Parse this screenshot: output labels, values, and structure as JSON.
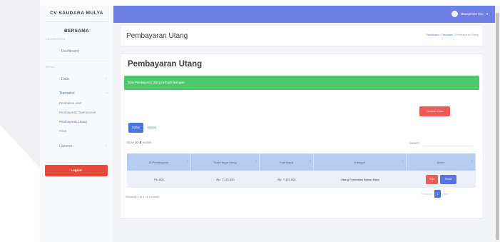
{
  "sidebar": {
    "brand": "CV SAUDARA MULYA",
    "company": "BERSAMA",
    "heading_dashboard": "DASHBOARD",
    "dashboard_label": "Dashboard",
    "heading_menu": "MENU",
    "data_label": "Data",
    "transaksi_label": "Transaksi",
    "sub_items": [
      "Pembelian Aset",
      "Pembayaran Operasional",
      "Pembayaran Utang",
      "Prive"
    ],
    "laporan_label": "Laporan",
    "logout_label": "Logout"
  },
  "topbar": {
    "user_name": "Manajemen keu."
  },
  "header": {
    "title": "Pembayaran Utang",
    "breadcrumb": [
      "Dashboard",
      "Transaksi",
      "Pembayaran Utang"
    ]
  },
  "main": {
    "title": "Pembayaran Utang",
    "alert": "Data Pembayaran Utang berhasil disimpan",
    "add_button": "Tambah Data",
    "tabs": [
      "Daftar",
      "History"
    ],
    "show_label": "Show",
    "show_value": "10",
    "entries_label": "entries",
    "search_label": "Search:",
    "table": {
      "headers": [
        "ID Pembayaran",
        "Total Harga Utang",
        "Total Bayar",
        "Kategori",
        "Action"
      ],
      "rows": [
        {
          "id": "PU-002",
          "total_harga": "Rp. 7.170.000",
          "total_bayar": "Rp. 7.170.000",
          "kategori": "Utang Pembelian Bahan Baku"
        }
      ],
      "edit_label": "Edit",
      "detail_label": "Detail"
    },
    "info": "Showing 1 to 1 of 1 entries",
    "pagination": {
      "previous": "Previous",
      "page": "1",
      "next": "Next"
    }
  },
  "colors": {
    "topbar": "#6f7fe8",
    "primary": "#4e73df",
    "success": "#4ec96c",
    "danger": "#ef5a58"
  }
}
